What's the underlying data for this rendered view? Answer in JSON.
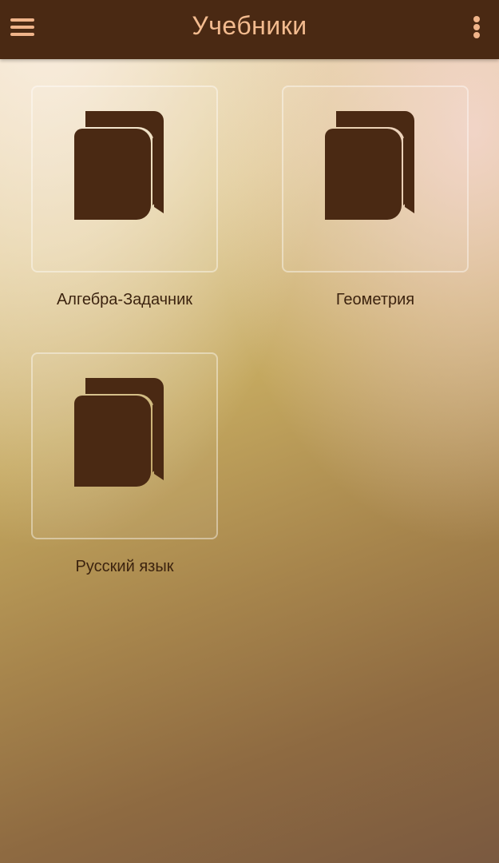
{
  "app_bar": {
    "title": "Учебники",
    "menu_icon": "hamburger-menu-icon",
    "overflow_icon": "more-vert-icon",
    "background": "#4a2913",
    "accent": "#f3bb8f"
  },
  "books": [
    {
      "label": "Алгебра-Задачник",
      "icon": "book-icon"
    },
    {
      "label": "Геометрия",
      "icon": "book-icon"
    },
    {
      "label": "Русский язык",
      "icon": "book-icon"
    }
  ],
  "colors": {
    "icon": "#4a2913",
    "label": "#3c230f"
  }
}
